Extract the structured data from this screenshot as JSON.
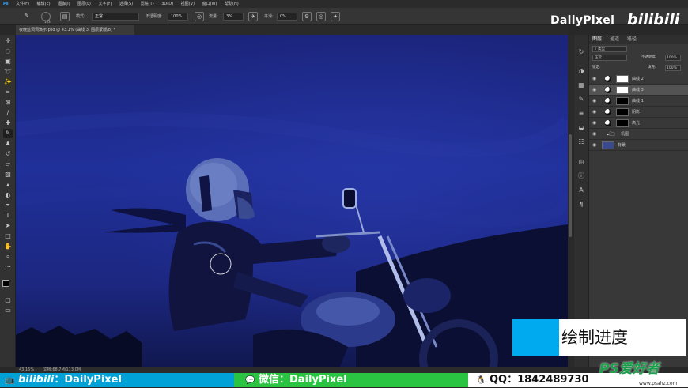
{
  "menubar": {
    "app_icon": "photoshop-icon",
    "items": [
      "文件(F)",
      "编辑(E)",
      "图像(I)",
      "图层(L)",
      "文字(Y)",
      "选择(S)",
      "滤镜(T)",
      "3D(D)",
      "视图(V)",
      "窗口(W)",
      "帮助(H)"
    ]
  },
  "options": {
    "mode_label": "模式:",
    "mode_value": "正常",
    "opacity_label": "不透明度:",
    "opacity_value": "100%",
    "flow_label": "流量:",
    "flow_value": "3%",
    "smooth_label": "平滑:",
    "smooth_value": "0%",
    "brush_size": "163"
  },
  "document": {
    "tab_title": "夜晚蓝调调演示.psd @ 43.1% (曲线 3, 图层蒙版/8) *",
    "zoom": "43.15%",
    "doc_info": "文档:68.7M/113.0M"
  },
  "layers_panel": {
    "tabs": [
      "图层",
      "通道",
      "路径"
    ],
    "filter_label": "类型",
    "blend_mode": "正常",
    "opacity_label": "不透明度:",
    "opacity_value": "100%",
    "lock_label": "锁定:",
    "fill_label": "填充:",
    "fill_value": "100%",
    "layers": [
      {
        "name": "曲线 2",
        "thumb": "white",
        "selected": false
      },
      {
        "name": "曲线 3",
        "thumb": "white",
        "selected": true
      },
      {
        "name": "曲线 1",
        "thumb": "dark",
        "selected": false
      },
      {
        "name": "阴影",
        "thumb": "dark",
        "selected": false
      },
      {
        "name": "高光",
        "thumb": "dark",
        "selected": false
      },
      {
        "name": "机图",
        "thumb": "none",
        "selected": false
      },
      {
        "name": "背景",
        "thumb": "photo",
        "selected": false
      }
    ]
  },
  "overlay": {
    "watermark": "DailyPixel",
    "bilibili_logo": "bilibili",
    "progress_label": "绘制进度",
    "progress_fraction": 0.27,
    "progress_color": "#00aaee"
  },
  "footer": {
    "segments": [
      {
        "icon": "bilibili-tv-icon",
        "brand": "bilibili",
        "text": "：DailyPixel",
        "bg": "#00a1d6"
      },
      {
        "icon": "wechat-icon",
        "brand": "微信",
        "text": "：DailyPixel",
        "bg": "#2bc442"
      },
      {
        "icon": "qq-penguin-icon",
        "brand": "QQ",
        "text": "：1842489730",
        "bg": "#ffffff"
      }
    ],
    "site_logo": "PS爱好者",
    "site_url": "www.psahz.com"
  },
  "colors": {
    "canvas_sky": "#1d2a8a",
    "panel_bg": "#383838",
    "accent": "#00aaee"
  }
}
